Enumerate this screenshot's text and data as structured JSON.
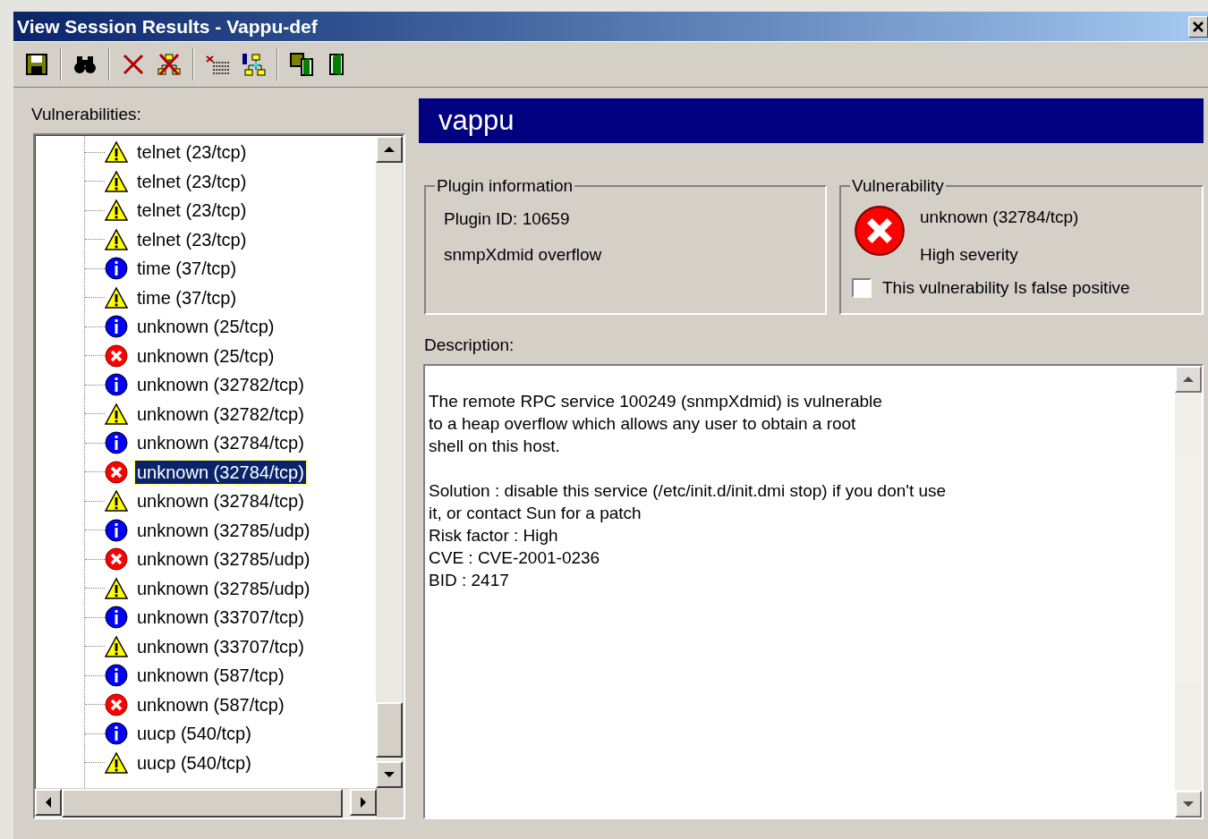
{
  "window": {
    "title": "View Session Results - Vappu-def"
  },
  "vulnerabilities": {
    "label": "Vulnerabilities:",
    "items": [
      {
        "label": "telnet (23/tcp)",
        "kind": "warning",
        "selected": false
      },
      {
        "label": "telnet (23/tcp)",
        "kind": "warning",
        "selected": false
      },
      {
        "label": "telnet (23/tcp)",
        "kind": "warning",
        "selected": false
      },
      {
        "label": "telnet (23/tcp)",
        "kind": "warning",
        "selected": false
      },
      {
        "label": "time (37/tcp)",
        "kind": "info",
        "selected": false
      },
      {
        "label": "time (37/tcp)",
        "kind": "warning",
        "selected": false
      },
      {
        "label": "unknown (25/tcp)",
        "kind": "info",
        "selected": false
      },
      {
        "label": "unknown (25/tcp)",
        "kind": "error",
        "selected": false
      },
      {
        "label": "unknown (32782/tcp)",
        "kind": "info",
        "selected": false
      },
      {
        "label": "unknown (32782/tcp)",
        "kind": "warning",
        "selected": false
      },
      {
        "label": "unknown (32784/tcp)",
        "kind": "info",
        "selected": false
      },
      {
        "label": "unknown (32784/tcp)",
        "kind": "error",
        "selected": true
      },
      {
        "label": "unknown (32784/tcp)",
        "kind": "warning",
        "selected": false
      },
      {
        "label": "unknown (32785/udp)",
        "kind": "info",
        "selected": false
      },
      {
        "label": "unknown (32785/udp)",
        "kind": "error",
        "selected": false
      },
      {
        "label": "unknown (32785/udp)",
        "kind": "warning",
        "selected": false
      },
      {
        "label": "unknown (33707/tcp)",
        "kind": "info",
        "selected": false
      },
      {
        "label": "unknown (33707/tcp)",
        "kind": "warning",
        "selected": false
      },
      {
        "label": "unknown (587/tcp)",
        "kind": "info",
        "selected": false
      },
      {
        "label": "unknown (587/tcp)",
        "kind": "error",
        "selected": false
      },
      {
        "label": "uucp (540/tcp)",
        "kind": "info",
        "selected": false
      },
      {
        "label": "uucp (540/tcp)",
        "kind": "warning",
        "selected": false
      }
    ]
  },
  "host": {
    "name": "vappu"
  },
  "plugin_information": {
    "title": "Plugin information",
    "plugin_id": "Plugin ID: 10659",
    "name": "snmpXdmid overflow"
  },
  "vulnerability": {
    "title": "Vulnerability",
    "kind": "error",
    "service": "unknown (32784/tcp)",
    "severity": "High severity",
    "false_positive": {
      "label": "This vulnerability Is false positive",
      "checked": false
    }
  },
  "description": {
    "label": "Description:",
    "paragraphs": [
      "The remote RPC service 100249 (snmpXdmid) is vulnerable\nto a heap overflow which allows any user to obtain a root\nshell on this host.",
      "Solution : disable this service (/etc/init.d/init.dmi stop) if you don't use\nit, or contact Sun for a patch\nRisk factor : High\nCVE : CVE-2001-0236\nBID : 2417"
    ]
  }
}
